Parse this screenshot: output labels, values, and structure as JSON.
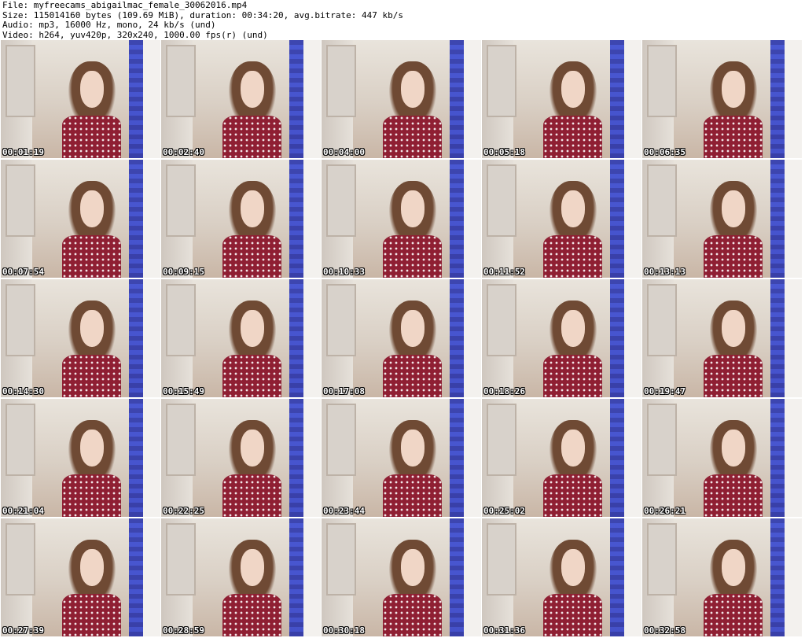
{
  "header": {
    "file": "File: myfreecams_abigailmac_female_30062016.mp4",
    "size": "Size: 115014160 bytes (109.69 MiB), duration: 00:34:20, avg.bitrate: 447 kb/s",
    "audio": "Audio: mp3, 16000 Hz, mono, 24 kb/s (und)",
    "video": "Video: h264, yuv420p, 320x240, 1000.00 fps(r) (und)"
  },
  "thumbnails": [
    {
      "timestamp": "00:01:19"
    },
    {
      "timestamp": "00:02:40"
    },
    {
      "timestamp": "00:04:00"
    },
    {
      "timestamp": "00:05:18"
    },
    {
      "timestamp": "00:06:35"
    },
    {
      "timestamp": "00:07:54"
    },
    {
      "timestamp": "00:09:15"
    },
    {
      "timestamp": "00:10:33"
    },
    {
      "timestamp": "00:11:52"
    },
    {
      "timestamp": "00:13:13"
    },
    {
      "timestamp": "00:14:30"
    },
    {
      "timestamp": "00:15:49"
    },
    {
      "timestamp": "00:17:08"
    },
    {
      "timestamp": "00:18:26"
    },
    {
      "timestamp": "00:19:47"
    },
    {
      "timestamp": "00:21:04"
    },
    {
      "timestamp": "00:22:25"
    },
    {
      "timestamp": "00:23:44"
    },
    {
      "timestamp": "00:25:02"
    },
    {
      "timestamp": "00:26:21"
    },
    {
      "timestamp": "00:27:39"
    },
    {
      "timestamp": "00:28:59"
    },
    {
      "timestamp": "00:30:18"
    },
    {
      "timestamp": "00:31:36"
    },
    {
      "timestamp": "00:32:58"
    }
  ]
}
